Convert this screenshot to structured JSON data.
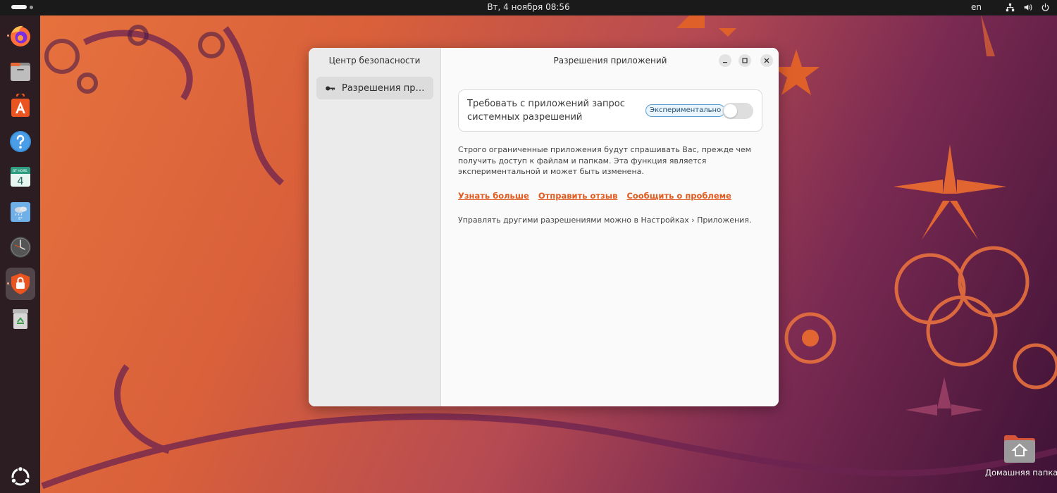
{
  "topbar": {
    "clock": "Вт, 4 ноября  08:56",
    "language": "en",
    "icons": [
      "network-icon",
      "volume-icon",
      "power-icon"
    ]
  },
  "dock": {
    "apps": [
      {
        "name": "Firefox",
        "icon": "firefox-icon"
      },
      {
        "name": "Files",
        "icon": "files-icon"
      },
      {
        "name": "App Center",
        "icon": "app-center-icon"
      },
      {
        "name": "Help",
        "icon": "help-icon"
      },
      {
        "name": "Calendar",
        "icon": "calendar-icon",
        "badge_top": "ВТ НОЯБ.",
        "badge_day": "4"
      },
      {
        "name": "Weather",
        "icon": "weather-icon",
        "temp": "8°"
      },
      {
        "name": "Clocks",
        "icon": "clock-icon"
      },
      {
        "name": "Security Center",
        "icon": "security-center-icon",
        "active": true
      },
      {
        "name": "Trash",
        "icon": "trash-icon"
      }
    ],
    "show_apps_icon": "ubuntu-logo-icon"
  },
  "window": {
    "sidebar_title": "Центр безопасности",
    "sidebar_items": [
      {
        "label": "Разрешения приложений",
        "icon": "key-icon"
      }
    ],
    "header_title": "Разрешения приложений",
    "controls": [
      "minimize-icon",
      "maximize-icon",
      "close-icon"
    ],
    "setting": {
      "label": "Требовать с приложений запрос системных разрешений",
      "badge": "Экспериментально",
      "enabled": false
    },
    "description": "Строго ограниченные приложения будут спрашивать Вас, прежде чем получить доступ к файлам и папкам. Эта функция является экспериментальной и может быть изменена.",
    "links": [
      "Узнать больше",
      "Отправить отзыв",
      "Сообщить о проблеме"
    ],
    "note": "Управлять другими разрешениями можно в Настройках › Приложения."
  },
  "desktop": {
    "home_folder_label": "Домашняя папка"
  },
  "colors": {
    "accent": "#e05a1e",
    "badge_border": "#5a9fd4",
    "topbar": "#1a1a1a",
    "dock": "#2b1d22"
  }
}
